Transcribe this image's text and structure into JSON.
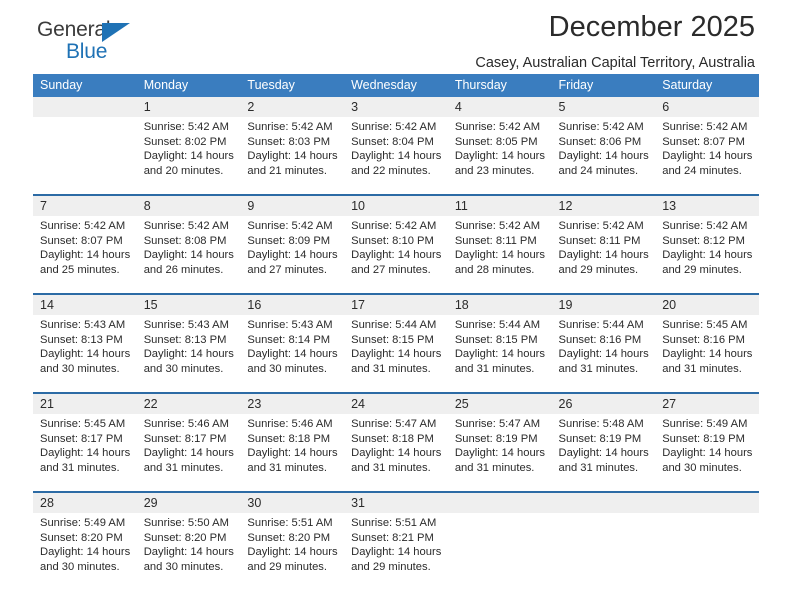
{
  "brand": {
    "name_part1": "General",
    "name_part2": "Blue",
    "accent_color": "#1f72b5",
    "logo_icon": "triangle-icon"
  },
  "header": {
    "title": "December 2025",
    "subtitle": "Casey, Australian Capital Territory, Australia"
  },
  "calendar": {
    "header_bg": "#3a7dbf",
    "header_text_color": "#ffffff",
    "separator_color": "#2c6ba5",
    "daynum_bg": "#efefef",
    "day_headers": [
      "Sunday",
      "Monday",
      "Tuesday",
      "Wednesday",
      "Thursday",
      "Friday",
      "Saturday"
    ],
    "weeks": [
      [
        {
          "day": "",
          "sunrise": "",
          "sunset": "",
          "daylight": ""
        },
        {
          "day": "1",
          "sunrise": "Sunrise: 5:42 AM",
          "sunset": "Sunset: 8:02 PM",
          "daylight": "Daylight: 14 hours and 20 minutes."
        },
        {
          "day": "2",
          "sunrise": "Sunrise: 5:42 AM",
          "sunset": "Sunset: 8:03 PM",
          "daylight": "Daylight: 14 hours and 21 minutes."
        },
        {
          "day": "3",
          "sunrise": "Sunrise: 5:42 AM",
          "sunset": "Sunset: 8:04 PM",
          "daylight": "Daylight: 14 hours and 22 minutes."
        },
        {
          "day": "4",
          "sunrise": "Sunrise: 5:42 AM",
          "sunset": "Sunset: 8:05 PM",
          "daylight": "Daylight: 14 hours and 23 minutes."
        },
        {
          "day": "5",
          "sunrise": "Sunrise: 5:42 AM",
          "sunset": "Sunset: 8:06 PM",
          "daylight": "Daylight: 14 hours and 24 minutes."
        },
        {
          "day": "6",
          "sunrise": "Sunrise: 5:42 AM",
          "sunset": "Sunset: 8:07 PM",
          "daylight": "Daylight: 14 hours and 24 minutes."
        }
      ],
      [
        {
          "day": "7",
          "sunrise": "Sunrise: 5:42 AM",
          "sunset": "Sunset: 8:07 PM",
          "daylight": "Daylight: 14 hours and 25 minutes."
        },
        {
          "day": "8",
          "sunrise": "Sunrise: 5:42 AM",
          "sunset": "Sunset: 8:08 PM",
          "daylight": "Daylight: 14 hours and 26 minutes."
        },
        {
          "day": "9",
          "sunrise": "Sunrise: 5:42 AM",
          "sunset": "Sunset: 8:09 PM",
          "daylight": "Daylight: 14 hours and 27 minutes."
        },
        {
          "day": "10",
          "sunrise": "Sunrise: 5:42 AM",
          "sunset": "Sunset: 8:10 PM",
          "daylight": "Daylight: 14 hours and 27 minutes."
        },
        {
          "day": "11",
          "sunrise": "Sunrise: 5:42 AM",
          "sunset": "Sunset: 8:11 PM",
          "daylight": "Daylight: 14 hours and 28 minutes."
        },
        {
          "day": "12",
          "sunrise": "Sunrise: 5:42 AM",
          "sunset": "Sunset: 8:11 PM",
          "daylight": "Daylight: 14 hours and 29 minutes."
        },
        {
          "day": "13",
          "sunrise": "Sunrise: 5:42 AM",
          "sunset": "Sunset: 8:12 PM",
          "daylight": "Daylight: 14 hours and 29 minutes."
        }
      ],
      [
        {
          "day": "14",
          "sunrise": "Sunrise: 5:43 AM",
          "sunset": "Sunset: 8:13 PM",
          "daylight": "Daylight: 14 hours and 30 minutes."
        },
        {
          "day": "15",
          "sunrise": "Sunrise: 5:43 AM",
          "sunset": "Sunset: 8:13 PM",
          "daylight": "Daylight: 14 hours and 30 minutes."
        },
        {
          "day": "16",
          "sunrise": "Sunrise: 5:43 AM",
          "sunset": "Sunset: 8:14 PM",
          "daylight": "Daylight: 14 hours and 30 minutes."
        },
        {
          "day": "17",
          "sunrise": "Sunrise: 5:44 AM",
          "sunset": "Sunset: 8:15 PM",
          "daylight": "Daylight: 14 hours and 31 minutes."
        },
        {
          "day": "18",
          "sunrise": "Sunrise: 5:44 AM",
          "sunset": "Sunset: 8:15 PM",
          "daylight": "Daylight: 14 hours and 31 minutes."
        },
        {
          "day": "19",
          "sunrise": "Sunrise: 5:44 AM",
          "sunset": "Sunset: 8:16 PM",
          "daylight": "Daylight: 14 hours and 31 minutes."
        },
        {
          "day": "20",
          "sunrise": "Sunrise: 5:45 AM",
          "sunset": "Sunset: 8:16 PM",
          "daylight": "Daylight: 14 hours and 31 minutes."
        }
      ],
      [
        {
          "day": "21",
          "sunrise": "Sunrise: 5:45 AM",
          "sunset": "Sunset: 8:17 PM",
          "daylight": "Daylight: 14 hours and 31 minutes."
        },
        {
          "day": "22",
          "sunrise": "Sunrise: 5:46 AM",
          "sunset": "Sunset: 8:17 PM",
          "daylight": "Daylight: 14 hours and 31 minutes."
        },
        {
          "day": "23",
          "sunrise": "Sunrise: 5:46 AM",
          "sunset": "Sunset: 8:18 PM",
          "daylight": "Daylight: 14 hours and 31 minutes."
        },
        {
          "day": "24",
          "sunrise": "Sunrise: 5:47 AM",
          "sunset": "Sunset: 8:18 PM",
          "daylight": "Daylight: 14 hours and 31 minutes."
        },
        {
          "day": "25",
          "sunrise": "Sunrise: 5:47 AM",
          "sunset": "Sunset: 8:19 PM",
          "daylight": "Daylight: 14 hours and 31 minutes."
        },
        {
          "day": "26",
          "sunrise": "Sunrise: 5:48 AM",
          "sunset": "Sunset: 8:19 PM",
          "daylight": "Daylight: 14 hours and 31 minutes."
        },
        {
          "day": "27",
          "sunrise": "Sunrise: 5:49 AM",
          "sunset": "Sunset: 8:19 PM",
          "daylight": "Daylight: 14 hours and 30 minutes."
        }
      ],
      [
        {
          "day": "28",
          "sunrise": "Sunrise: 5:49 AM",
          "sunset": "Sunset: 8:20 PM",
          "daylight": "Daylight: 14 hours and 30 minutes."
        },
        {
          "day": "29",
          "sunrise": "Sunrise: 5:50 AM",
          "sunset": "Sunset: 8:20 PM",
          "daylight": "Daylight: 14 hours and 30 minutes."
        },
        {
          "day": "30",
          "sunrise": "Sunrise: 5:51 AM",
          "sunset": "Sunset: 8:20 PM",
          "daylight": "Daylight: 14 hours and 29 minutes."
        },
        {
          "day": "31",
          "sunrise": "Sunrise: 5:51 AM",
          "sunset": "Sunset: 8:21 PM",
          "daylight": "Daylight: 14 hours and 29 minutes."
        },
        {
          "day": "",
          "sunrise": "",
          "sunset": "",
          "daylight": ""
        },
        {
          "day": "",
          "sunrise": "",
          "sunset": "",
          "daylight": ""
        },
        {
          "day": "",
          "sunrise": "",
          "sunset": "",
          "daylight": ""
        }
      ]
    ]
  }
}
